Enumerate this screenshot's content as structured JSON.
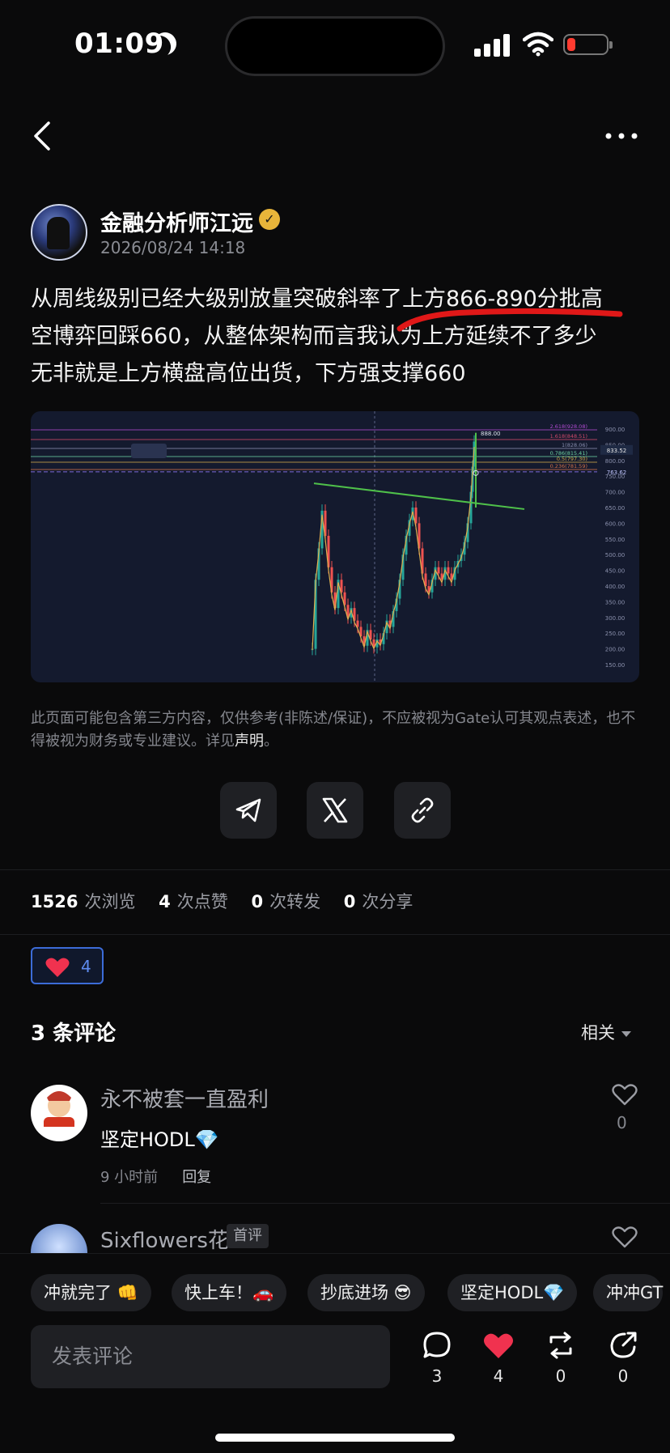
{
  "status_bar": {
    "time": "01:09"
  },
  "author": {
    "name": "金融分析师江远",
    "time": "2026/08/24 14:18"
  },
  "post": {
    "lines": [
      "从周线级别已经大级别放量突破斜率了上方866-890分批高",
      "空博弈回踩660，从整体架构而言我认为上方延续不了多少",
      "无非就是上方横盘高位出货，下方强支撑660"
    ]
  },
  "chart": {
    "price_labels": [
      "900.00",
      "850.00",
      "800.00",
      "750.00",
      "700.00",
      "650.00",
      "600.00",
      "550.00",
      "500.00",
      "450.00",
      "400.00",
      "350.00",
      "300.00",
      "250.00",
      "200.00",
      "150.00"
    ],
    "fib_labels": [
      "2.618(928.08)",
      "1.618(848.51)",
      "1(828.06)",
      "0.786(815.41)",
      "0.5(797.30)",
      "0.236(781.59)"
    ],
    "marker_high": "888.00",
    "current_price": "833.52",
    "level_label": "763.62",
    "colors": {
      "background": "#141a2e",
      "trendline": "#4fc04a",
      "up": "#26a69a",
      "down": "#ef5350"
    }
  },
  "disclaimer": {
    "text": "此页面可能包含第三方内容，仅供参考(非陈述/保证)，不应被视为Gate认可其观点表述，也不得被视为财务或专业建议。详见",
    "link": "声明",
    "end": "。"
  },
  "stats": {
    "views": "1526",
    "views_label": "次浏览",
    "likes": "4",
    "likes_label": "次点赞",
    "reposts": "0",
    "reposts_label": "次转发",
    "shares": "0",
    "shares_label": "次分享"
  },
  "like_pill": {
    "count": "4"
  },
  "comments": {
    "title": "3 条评论",
    "sort": "相关",
    "items": [
      {
        "user": "永不被套一直盈利",
        "text": "坚定HODL💎",
        "time": "9 小时前",
        "reply": "回复",
        "likes": "0"
      },
      {
        "user": "Sixflowers花",
        "badge": "首评"
      }
    ]
  },
  "quick_replies": [
    "冲就完了 👊",
    "快上车！🚗",
    "抄底进场 😎",
    "坚定HODL💎",
    "冲冲GT"
  ],
  "composer": {
    "placeholder": "发表评论"
  },
  "actions": {
    "comments": "3",
    "likes": "4",
    "reposts": "0",
    "shares": "0"
  }
}
